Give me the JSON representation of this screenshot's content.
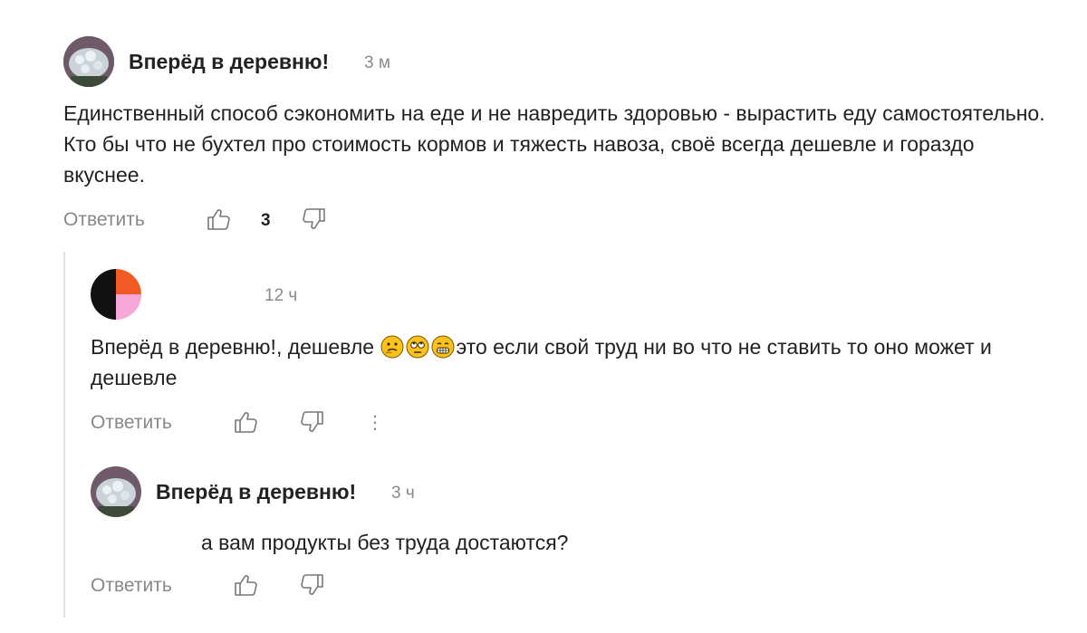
{
  "comments": [
    {
      "author": "Вперёд в деревню!",
      "time": "3 м",
      "text": "Единственный способ сэкономить на еде и не навредить здоровью - вырастить еду самостоятельно. Кто бы что не бухтел про стоимость кормов и тяжесть навоза, своё всегда дешевле и гораздо вкуснее.",
      "reply_label": "Ответить",
      "likes": "3"
    },
    {
      "author": "",
      "time": "12 ч",
      "text_before_emoji": "Вперёд в деревню!, дешевле ",
      "text_after_emoji": "это если свой труд ни во что не ставить то оно может и дешевле",
      "emojis": [
        "thinking-emoji",
        "eye-roll-emoji",
        "grinning-emoji"
      ],
      "reply_label": "Ответить",
      "more_label": "⋮"
    },
    {
      "author": "Вперёд в деревню!",
      "time": "3 ч",
      "text": "а вам продукты без труда достаются?",
      "reply_label": "Ответить"
    }
  ],
  "icons": {
    "like": "thumb-up-icon",
    "dislike": "thumb-down-icon"
  }
}
